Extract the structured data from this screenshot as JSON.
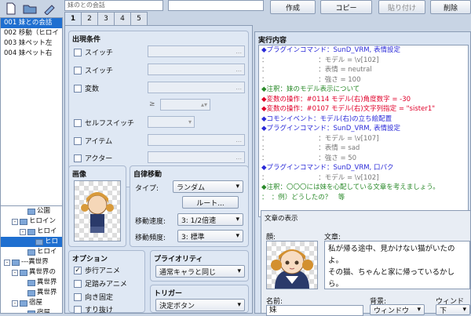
{
  "title_field": "妹のとの会話",
  "buttons": {
    "create": "作成",
    "copy": "コピー",
    "paste": "貼り付け",
    "delete": "削除"
  },
  "event_list": [
    {
      "label": "001 妹との会話",
      "selected": true
    },
    {
      "label": "002 移動（ヒロイ",
      "selected": false
    },
    {
      "label": "003 妹ペット左",
      "selected": false
    },
    {
      "label": "004 妹ペット右",
      "selected": false
    }
  ],
  "tree": [
    {
      "label": "公園",
      "indent": 2,
      "box": "",
      "selected": false
    },
    {
      "label": "ヒロイン",
      "indent": 1,
      "box": "-",
      "selected": false
    },
    {
      "label": "ヒロイ",
      "indent": 2,
      "box": "-",
      "selected": false
    },
    {
      "label": "ヒロ",
      "indent": 3,
      "box": "",
      "selected": true
    },
    {
      "label": "ヒロイ",
      "indent": 2,
      "box": "",
      "selected": false
    },
    {
      "label": "---異世界",
      "indent": 0,
      "box": "-",
      "selected": false
    },
    {
      "label": "異世界の",
      "indent": 1,
      "box": "-",
      "selected": false
    },
    {
      "label": "異世界",
      "indent": 2,
      "box": "",
      "selected": false
    },
    {
      "label": "異世界",
      "indent": 2,
      "box": "",
      "selected": false
    },
    {
      "label": "宿屋",
      "indent": 1,
      "box": "-",
      "selected": false
    },
    {
      "label": "宿屋",
      "indent": 2,
      "box": "",
      "selected": false
    }
  ],
  "tabs": [
    "1",
    "2",
    "3",
    "4",
    "5"
  ],
  "conditions": {
    "title": "出現条件",
    "switch1": "スイッチ",
    "switch2": "スイッチ",
    "variable": "変数",
    "gte": "≥",
    "self_switch": "セルフスイッチ",
    "item": "アイテム",
    "actor": "アクター",
    "ellipsis": "..."
  },
  "image": {
    "title": "画像"
  },
  "autonomous": {
    "title": "自律移動",
    "type_label": "タイプ:",
    "type_value": "ランダム",
    "route_button": "ルート...",
    "speed_label": "移動速度:",
    "speed_value": "3: 1/2倍速",
    "freq_label": "移動頻度:",
    "freq_value": "3: 標準"
  },
  "options": {
    "title": "オプション",
    "walk_anim": "歩行アニメ",
    "step_anim": "足踏みアニメ",
    "dir_fix": "向き固定",
    "through": "すり抜け"
  },
  "priority": {
    "title": "プライオリティ",
    "value": "通常キャラと同じ"
  },
  "trigger": {
    "title": "トリガー",
    "value": "決定ボタン"
  },
  "execution": {
    "title": "実行内容",
    "lines": [
      {
        "t": "◆プラグインコマンド：SunD_VRM, 表情設定",
        "c": "c-blue"
      },
      {
        "t": "：　　　　　　　　：モデル = \\v[102]",
        "c": "c-gray"
      },
      {
        "t": "：　　　　　　　　：表情 = neutral",
        "c": "c-gray"
      },
      {
        "t": "：　　　　　　　　：強さ = 100",
        "c": "c-gray"
      },
      {
        "t": "◆注釈：妹のモデル表示について",
        "c": "c-green"
      },
      {
        "t": "◆変数の操作：#0114 モデル(右)角度数字 = -30",
        "c": "c-red"
      },
      {
        "t": "◆変数の操作：#0107 モデル(右)文字列指定 = \"sister1\"",
        "c": "c-red"
      },
      {
        "t": "◆コモンイベント：モデル(右)の立ち絵配置",
        "c": "c-blue"
      },
      {
        "t": "◆プラグインコマンド：SunD_VRM, 表情設定",
        "c": "c-blue"
      },
      {
        "t": "：　　　　　　　　：モデル = \\v[107]",
        "c": "c-gray"
      },
      {
        "t": "：　　　　　　　　：表情 = sad",
        "c": "c-gray"
      },
      {
        "t": "：　　　　　　　　：強さ = 50",
        "c": "c-gray"
      },
      {
        "t": "◆プラグインコマンド：SunD_VRM, 口パク",
        "c": "c-blue"
      },
      {
        "t": "：　　　　　　　　：モデル = \\v[102]",
        "c": "c-gray"
      },
      {
        "t": "◆注釈：〇〇〇には妹を心配している文章を考えましょう。",
        "c": "c-green"
      },
      {
        "t": "：　：例）どうしたの？　等",
        "c": "c-green"
      }
    ]
  },
  "show_text": {
    "title": "文章の表示",
    "face_label": "顔:",
    "text_label": "文章:",
    "text_line1": "私が帰る途中、見かけない猫がいたのよ。",
    "text_line2": "その猫、ちゃんと家に帰っているかしら。",
    "name_label": "名前:",
    "name_value": "妹",
    "bg_label": "背景:",
    "bg_value": "ウィンドウ",
    "pos_label": "ウィンドウ",
    "pos_value": "下"
  }
}
